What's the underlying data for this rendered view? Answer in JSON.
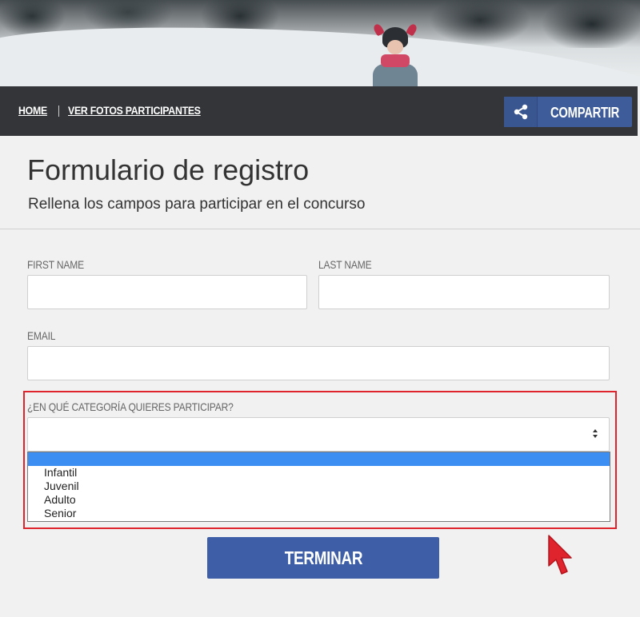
{
  "nav": {
    "home": "HOME",
    "fotos": "VER FOTOS PARTICIPANTES",
    "share": "COMPARTIR",
    "share_icon": "share-icon"
  },
  "heading": {
    "title": "Formulario de registro",
    "subtitle": "Rellena los campos para participar en el concurso"
  },
  "form": {
    "first_name_label": "FIRST NAME",
    "first_name_value": "",
    "last_name_label": "LAST NAME",
    "last_name_value": "",
    "email_label": "EMAIL",
    "email_value": "",
    "category_label": "¿EN QUÉ CATEGORÍA QUIERES PARTICIPAR?",
    "category_selected": "",
    "category_options": [
      "",
      "Infantil",
      "Juvenil",
      "Adulto",
      "Senior"
    ],
    "submit": "TERMINAR"
  },
  "colors": {
    "navbar": "#333538",
    "share_button": "#3e5c9a",
    "submit_button": "#3e5fa8",
    "highlight": "#e0242e",
    "option_selected": "#3c8ef3"
  }
}
